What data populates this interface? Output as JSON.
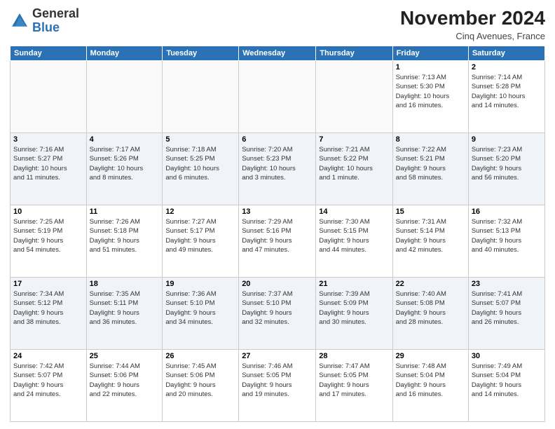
{
  "logo": {
    "general": "General",
    "blue": "Blue"
  },
  "header": {
    "month": "November 2024",
    "location": "Cinq Avenues, France"
  },
  "weekdays": [
    "Sunday",
    "Monday",
    "Tuesday",
    "Wednesday",
    "Thursday",
    "Friday",
    "Saturday"
  ],
  "weeks": [
    [
      {
        "day": "",
        "info": ""
      },
      {
        "day": "",
        "info": ""
      },
      {
        "day": "",
        "info": ""
      },
      {
        "day": "",
        "info": ""
      },
      {
        "day": "",
        "info": ""
      },
      {
        "day": "1",
        "info": "Sunrise: 7:13 AM\nSunset: 5:30 PM\nDaylight: 10 hours\nand 16 minutes."
      },
      {
        "day": "2",
        "info": "Sunrise: 7:14 AM\nSunset: 5:28 PM\nDaylight: 10 hours\nand 14 minutes."
      }
    ],
    [
      {
        "day": "3",
        "info": "Sunrise: 7:16 AM\nSunset: 5:27 PM\nDaylight: 10 hours\nand 11 minutes."
      },
      {
        "day": "4",
        "info": "Sunrise: 7:17 AM\nSunset: 5:26 PM\nDaylight: 10 hours\nand 8 minutes."
      },
      {
        "day": "5",
        "info": "Sunrise: 7:18 AM\nSunset: 5:25 PM\nDaylight: 10 hours\nand 6 minutes."
      },
      {
        "day": "6",
        "info": "Sunrise: 7:20 AM\nSunset: 5:23 PM\nDaylight: 10 hours\nand 3 minutes."
      },
      {
        "day": "7",
        "info": "Sunrise: 7:21 AM\nSunset: 5:22 PM\nDaylight: 10 hours\nand 1 minute."
      },
      {
        "day": "8",
        "info": "Sunrise: 7:22 AM\nSunset: 5:21 PM\nDaylight: 9 hours\nand 58 minutes."
      },
      {
        "day": "9",
        "info": "Sunrise: 7:23 AM\nSunset: 5:20 PM\nDaylight: 9 hours\nand 56 minutes."
      }
    ],
    [
      {
        "day": "10",
        "info": "Sunrise: 7:25 AM\nSunset: 5:19 PM\nDaylight: 9 hours\nand 54 minutes."
      },
      {
        "day": "11",
        "info": "Sunrise: 7:26 AM\nSunset: 5:18 PM\nDaylight: 9 hours\nand 51 minutes."
      },
      {
        "day": "12",
        "info": "Sunrise: 7:27 AM\nSunset: 5:17 PM\nDaylight: 9 hours\nand 49 minutes."
      },
      {
        "day": "13",
        "info": "Sunrise: 7:29 AM\nSunset: 5:16 PM\nDaylight: 9 hours\nand 47 minutes."
      },
      {
        "day": "14",
        "info": "Sunrise: 7:30 AM\nSunset: 5:15 PM\nDaylight: 9 hours\nand 44 minutes."
      },
      {
        "day": "15",
        "info": "Sunrise: 7:31 AM\nSunset: 5:14 PM\nDaylight: 9 hours\nand 42 minutes."
      },
      {
        "day": "16",
        "info": "Sunrise: 7:32 AM\nSunset: 5:13 PM\nDaylight: 9 hours\nand 40 minutes."
      }
    ],
    [
      {
        "day": "17",
        "info": "Sunrise: 7:34 AM\nSunset: 5:12 PM\nDaylight: 9 hours\nand 38 minutes."
      },
      {
        "day": "18",
        "info": "Sunrise: 7:35 AM\nSunset: 5:11 PM\nDaylight: 9 hours\nand 36 minutes."
      },
      {
        "day": "19",
        "info": "Sunrise: 7:36 AM\nSunset: 5:10 PM\nDaylight: 9 hours\nand 34 minutes."
      },
      {
        "day": "20",
        "info": "Sunrise: 7:37 AM\nSunset: 5:10 PM\nDaylight: 9 hours\nand 32 minutes."
      },
      {
        "day": "21",
        "info": "Sunrise: 7:39 AM\nSunset: 5:09 PM\nDaylight: 9 hours\nand 30 minutes."
      },
      {
        "day": "22",
        "info": "Sunrise: 7:40 AM\nSunset: 5:08 PM\nDaylight: 9 hours\nand 28 minutes."
      },
      {
        "day": "23",
        "info": "Sunrise: 7:41 AM\nSunset: 5:07 PM\nDaylight: 9 hours\nand 26 minutes."
      }
    ],
    [
      {
        "day": "24",
        "info": "Sunrise: 7:42 AM\nSunset: 5:07 PM\nDaylight: 9 hours\nand 24 minutes."
      },
      {
        "day": "25",
        "info": "Sunrise: 7:44 AM\nSunset: 5:06 PM\nDaylight: 9 hours\nand 22 minutes."
      },
      {
        "day": "26",
        "info": "Sunrise: 7:45 AM\nSunset: 5:06 PM\nDaylight: 9 hours\nand 20 minutes."
      },
      {
        "day": "27",
        "info": "Sunrise: 7:46 AM\nSunset: 5:05 PM\nDaylight: 9 hours\nand 19 minutes."
      },
      {
        "day": "28",
        "info": "Sunrise: 7:47 AM\nSunset: 5:05 PM\nDaylight: 9 hours\nand 17 minutes."
      },
      {
        "day": "29",
        "info": "Sunrise: 7:48 AM\nSunset: 5:04 PM\nDaylight: 9 hours\nand 16 minutes."
      },
      {
        "day": "30",
        "info": "Sunrise: 7:49 AM\nSunset: 5:04 PM\nDaylight: 9 hours\nand 14 minutes."
      }
    ]
  ]
}
